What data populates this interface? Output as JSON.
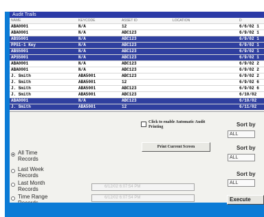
{
  "window": {
    "title": "Audit Trails"
  },
  "grid": {
    "columns": [
      "NAME",
      "KEYCODE",
      "ASSET ID",
      "LOCATION",
      "D"
    ],
    "rows": [
      {
        "name": "ABA0001",
        "keycode": "N/A",
        "asset": "12",
        "location": "",
        "date": "6/6/02 1",
        "selected": false
      },
      {
        "name": "ABA0001",
        "keycode": "N/A",
        "asset": "ABC123",
        "location": "",
        "date": "6/9/02 1",
        "selected": false
      },
      {
        "name": "ABS5001",
        "keycode": "N/A",
        "asset": "ABC123",
        "location": "",
        "date": "6/9/02 1",
        "selected": true
      },
      {
        "name": "PPS1-1 Key",
        "keycode": "N/A",
        "asset": "ABC123",
        "location": "",
        "date": "6/9/02 1",
        "selected": true
      },
      {
        "name": "ABS5001",
        "keycode": "N/A",
        "asset": "ABC123",
        "location": "",
        "date": "6/9/02 1",
        "selected": true
      },
      {
        "name": "APS5001",
        "keycode": "N/A",
        "asset": "ABC123",
        "location": "",
        "date": "6/9/02 1",
        "selected": true
      },
      {
        "name": "ABA0001",
        "keycode": "N/A",
        "asset": "ABC123",
        "location": "",
        "date": "6/9/02 2",
        "selected": false
      },
      {
        "name": "ABA0001",
        "keycode": "N/A",
        "asset": "ABC123",
        "location": "",
        "date": "6/9/02 2",
        "selected": false
      },
      {
        "name": "J. Smith",
        "keycode": "ABA5001",
        "asset": "ABC123",
        "location": "",
        "date": "6/9/02 2",
        "selected": false
      },
      {
        "name": "J. Smith",
        "keycode": "ABA5001",
        "asset": "12",
        "location": "",
        "date": "6/9/02 6",
        "selected": false
      },
      {
        "name": "J. Smith",
        "keycode": "ABA5001",
        "asset": "ABC123",
        "location": "",
        "date": "6/9/02 6",
        "selected": false
      },
      {
        "name": "J. Smith",
        "keycode": "ABA5001",
        "asset": "ABC123",
        "location": "",
        "date": "6/10/02",
        "selected": false
      },
      {
        "name": "ABA0001",
        "keycode": "N/A",
        "asset": "ABC123",
        "location": "",
        "date": "6/10/02",
        "selected": true
      },
      {
        "name": "J. Smith",
        "keycode": "ABA5001",
        "asset": "12",
        "location": "",
        "date": "6/11/02",
        "selected": true
      }
    ]
  },
  "range": {
    "options": [
      {
        "label": "All Time Records",
        "selected": true
      },
      {
        "label": "Last Week Records",
        "selected": false
      },
      {
        "label": "Last Month Records",
        "selected": false
      },
      {
        "label": "Time Range Records",
        "selected": false
      }
    ],
    "date_from": "6/12/02 6:07:54 PM",
    "date_to": "6/12/02 6:07:54 PM"
  },
  "options": {
    "auto_print_label": "Click to enable Automatic Audit Printing",
    "print_button": "Print Current Screen"
  },
  "sort": {
    "label": "Sort by",
    "values": [
      "ALL",
      "ALL",
      "ALL"
    ]
  },
  "execute_label": "Execute"
}
